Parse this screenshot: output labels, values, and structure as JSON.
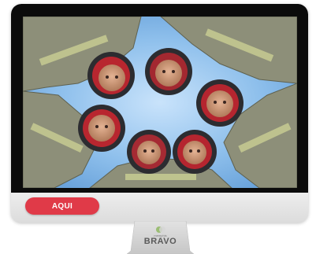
{
  "cta": {
    "label": "AQUI"
  },
  "logo": {
    "small_text": "memphis",
    "name": "BRAVO"
  },
  "colors": {
    "accent": "#e03a48",
    "bezel": "#0b0b0b",
    "frame": "#e4e4e4",
    "sky": "#8fc0ec"
  },
  "photo": {
    "icon": "firefighters-huddle-photo"
  }
}
